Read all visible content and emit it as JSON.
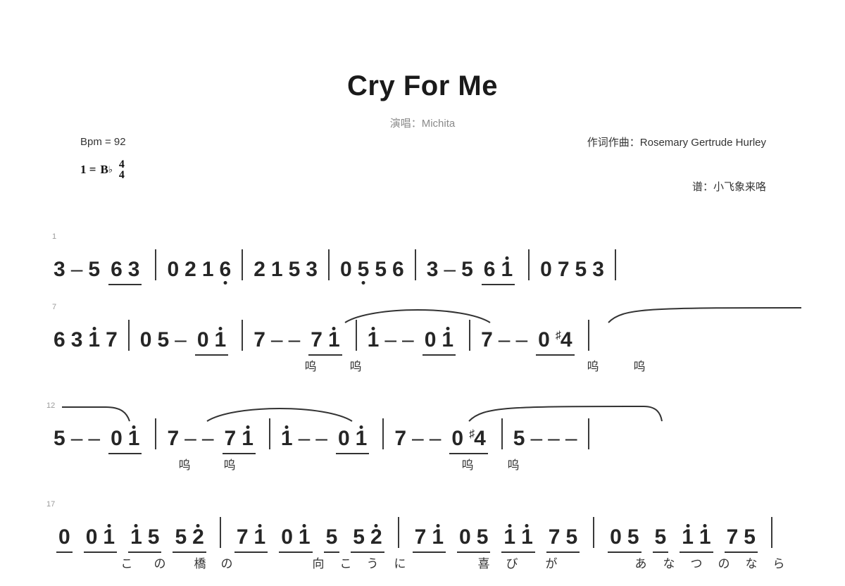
{
  "header": {
    "title": "Cry For Me",
    "subtitle": "演唱：Michita",
    "bpm": "Bpm = 92",
    "key_prefix": "1 =",
    "key_letter": "B",
    "key_accidental": "♭",
    "time_numerator": "4",
    "time_denominator": "4",
    "composer": "作词作曲：Rosemary Gertrude Hurley",
    "arranger": "谱：小飞象来咯"
  },
  "score": {
    "lines": [
      {
        "measure_number": "1",
        "measures": [
          {
            "notes": [
              "3",
              "–",
              "5",
              "6",
              "3"
            ]
          },
          {
            "notes": [
              "0",
              "2",
              "1",
              "6"
            ]
          },
          {
            "notes": [
              "2",
              "1",
              "5",
              "3"
            ]
          },
          {
            "notes": [
              "0",
              "5",
              "5",
              "6"
            ]
          },
          {
            "notes": [
              "3",
              "–",
              "5",
              "6",
              "1"
            ]
          },
          {
            "notes": [
              "0",
              "7",
              "5",
              "3"
            ]
          }
        ],
        "lyrics": []
      },
      {
        "measure_number": "7",
        "measures": [
          {
            "notes": [
              "6",
              "3",
              "1",
              "7"
            ]
          },
          {
            "notes": [
              "0",
              "5",
              "–",
              "0",
              "1"
            ]
          },
          {
            "notes": [
              "7",
              "–",
              "–",
              "7",
              "1"
            ]
          },
          {
            "notes": [
              "1",
              "–",
              "–",
              "0",
              "1"
            ]
          },
          {
            "notes": [
              "7",
              "–",
              "–",
              "0",
              "♯4"
            ]
          }
        ],
        "lyrics": [
          "呜",
          "呜",
          "呜",
          "呜"
        ]
      },
      {
        "measure_number": "12",
        "measures": [
          {
            "notes": [
              "5",
              "–",
              "–",
              "0",
              "1"
            ]
          },
          {
            "notes": [
              "7",
              "–",
              "–",
              "7",
              "1"
            ]
          },
          {
            "notes": [
              "1",
              "–",
              "–",
              "0",
              "1"
            ]
          },
          {
            "notes": [
              "7",
              "–",
              "–",
              "0",
              "♯4"
            ]
          },
          {
            "notes": [
              "5",
              "–",
              "–",
              "–"
            ]
          }
        ],
        "lyrics": [
          "呜",
          "呜",
          "呜",
          "呜"
        ]
      },
      {
        "measure_number": "17",
        "measures": [
          {
            "notes": [
              "0",
              "0",
              "1",
              "1",
              "5",
              "5",
              "2"
            ]
          },
          {
            "notes": [
              "7",
              "1",
              "0",
              "1",
              "5",
              "5",
              "2"
            ]
          },
          {
            "notes": [
              "7",
              "1",
              "0",
              "5",
              "1",
              "1",
              "7",
              "5"
            ]
          },
          {
            "notes": [
              "0",
              "5",
              "5",
              "1",
              "1",
              "7",
              "5"
            ]
          }
        ],
        "lyrics": [
          "こ",
          "の",
          "橋",
          "の",
          "向",
          "こ",
          "う",
          "に",
          "喜",
          "び",
          "が",
          "あ",
          "な",
          "つ",
          "の",
          "な",
          "ら"
        ]
      }
    ]
  }
}
